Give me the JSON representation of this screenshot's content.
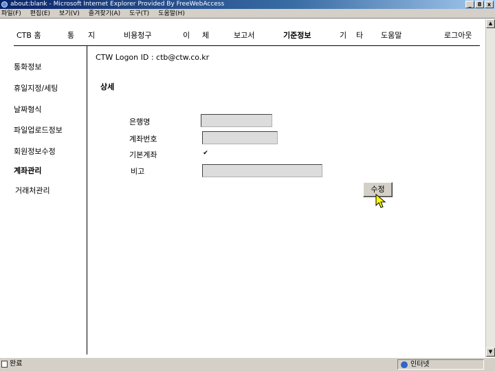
{
  "window": {
    "title": "about:blank - Microsoft Internet Explorer Provided By FreeWebAccess",
    "buttons": [
      "_",
      "8",
      "x"
    ]
  },
  "menubar": [
    "파일(F)",
    "편집(E)",
    "보기(V)",
    "즐겨찾기(A)",
    "도구(T)",
    "도움말(H)"
  ],
  "nav": [
    {
      "label": "CTB 홈"
    },
    {
      "label": "통"
    },
    {
      "label": "지"
    },
    {
      "label": "비용청구"
    },
    {
      "label": "이"
    },
    {
      "label": "체"
    },
    {
      "label": "보고서"
    },
    {
      "label": "기준정보"
    },
    {
      "label": "기"
    },
    {
      "label": "타"
    },
    {
      "label": "도움말"
    },
    {
      "label": "로그아웃"
    }
  ],
  "sidebar": [
    "통화정보",
    "휴일지정/세팅",
    "날짜형식",
    "파일업로드정보",
    "회원정보수정",
    "계좌관리",
    "거래처관리"
  ],
  "logon": "CTW Logon ID : ctb@ctw.co.kr",
  "section_title": "상세",
  "form": {
    "bank_label": "은행명",
    "bank_value": "",
    "account_label": "계좌번호",
    "account_value": "",
    "default_label": "기본계좌",
    "default_checked": true,
    "default_mark": "✔",
    "note_label": "비고",
    "note_value": "",
    "submit_label": "수정"
  },
  "statusbar": {
    "left": "완료",
    "right": "인터넷"
  }
}
